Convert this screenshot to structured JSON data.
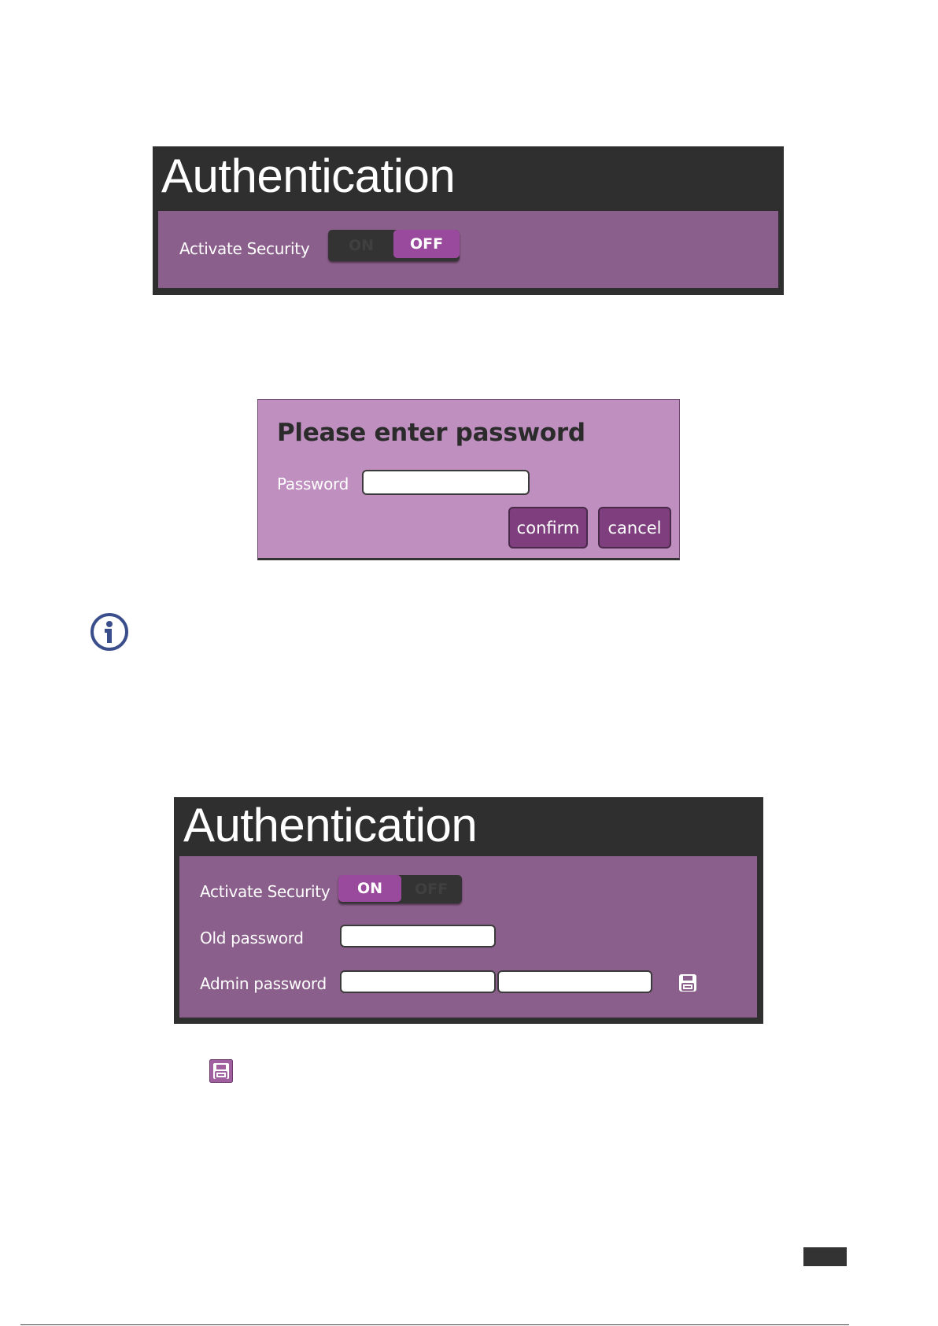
{
  "panel1": {
    "title": "Authentication",
    "activate_security_label": "Activate Security",
    "toggle": {
      "on_label": "ON",
      "off_label": "OFF",
      "state": "OFF"
    }
  },
  "dialog": {
    "title": "Please enter password",
    "password_label": "Password",
    "password_value": "",
    "confirm_label": "confirm",
    "cancel_label": "cancel"
  },
  "info": {
    "icon": "info-icon"
  },
  "panel2": {
    "title": "Authentication",
    "activate_security_label": "Activate Security",
    "toggle": {
      "on_label": "ON",
      "off_label": "OFF",
      "state": "ON"
    },
    "old_password_label": "Old password",
    "admin_password_label": "Admin password",
    "old_password_value": "",
    "admin_password_value": "",
    "admin_password_confirm_value": "",
    "save_icon": "save-icon"
  },
  "standalone_save_icon": "save-icon",
  "colors": {
    "panel_header": "#2f2f2f",
    "panel_body": "#8b5f8b",
    "toggle_active": "#9a4a9c",
    "dialog_bg": "#bf8fbf",
    "button_bg": "#7f3f7f",
    "info_icon": "#3a4e8c"
  }
}
